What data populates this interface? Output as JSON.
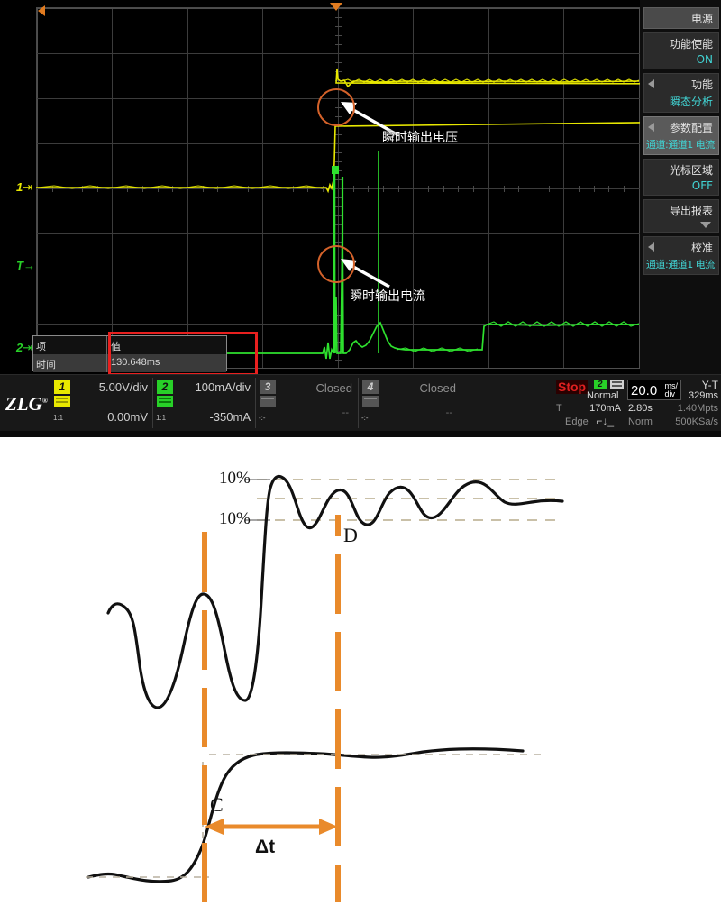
{
  "scope": {
    "annotations": [
      {
        "id": "voltage",
        "label": "瞬时输出电压"
      },
      {
        "id": "current",
        "label": "瞬时输出电流"
      }
    ],
    "channel_markers": [
      {
        "name": "ch1-marker",
        "label": "1",
        "color": "#e8e800"
      },
      {
        "name": "trigger-marker",
        "label": "T",
        "color": "#28d028"
      },
      {
        "name": "ch2-marker",
        "label": "2",
        "color": "#28d028"
      }
    ],
    "measurement_table": {
      "headers": [
        "项",
        "值"
      ],
      "rows": [
        {
          "item": "时间",
          "value": "130.648ms"
        }
      ],
      "highlight_color": "#e8201f"
    }
  },
  "menu": {
    "title": "电源",
    "items": [
      {
        "title": "功能使能",
        "value": "ON",
        "selected": false,
        "caret": "none"
      },
      {
        "title": "功能",
        "value": "瞬态分析",
        "selected": false,
        "caret": "left"
      },
      {
        "title": "参数配置",
        "value": "通道:通道1  电流",
        "selected": true,
        "caret": "left"
      },
      {
        "title": "光标区域",
        "value": "OFF",
        "selected": false,
        "caret": "none"
      },
      {
        "title": "导出报表",
        "value": "",
        "selected": false,
        "caret": "down"
      },
      {
        "title": "校准",
        "value": "通道:通道1  电流",
        "selected": false,
        "caret": "left"
      }
    ]
  },
  "statusbar": {
    "logo": "ZLG",
    "logo_sup": "®",
    "channels": [
      {
        "id": "1",
        "scale": "5.00V/div",
        "offset": "0.00mV",
        "ratio": "1:1",
        "state": "on",
        "color": "#e8e800"
      },
      {
        "id": "2",
        "scale": "100mA/div",
        "offset": "-350mA",
        "ratio": "1:1",
        "state": "on",
        "color": "#28d028"
      },
      {
        "id": "3",
        "scale": "Closed",
        "offset": "--",
        "ratio": "-:-",
        "state": "closed",
        "color": "#555555"
      },
      {
        "id": "4",
        "scale": "Closed",
        "offset": "--",
        "ratio": "-:-",
        "state": "closed",
        "color": "#555555"
      }
    ],
    "trigger": {
      "status": "Stop",
      "source": "2",
      "mode": "Normal",
      "label_t": "T",
      "level": "170mA",
      "type": "Edge"
    },
    "timebase": {
      "scale_value": "20.0",
      "scale_unit_top": "ms/",
      "scale_unit_bottom": "div",
      "format": "Y-T",
      "delay": "329ms",
      "memory_time": "2.80s",
      "memory_depth": "1.40Mpts",
      "acq_mode": "Norm",
      "sample_rate": "500KSa/s"
    }
  },
  "diagram": {
    "labels": [
      {
        "name": "upper-threshold-label",
        "text": "10%"
      },
      {
        "name": "lower-threshold-label",
        "text": "10%"
      },
      {
        "name": "point-d-label",
        "text": "D"
      },
      {
        "name": "point-c-label",
        "text": "C"
      },
      {
        "name": "delta-t-label",
        "text": "Δt"
      }
    ],
    "marker_color": "#e98a2b",
    "curve_color": "#111111",
    "dash_color": "#c9c0a8"
  }
}
